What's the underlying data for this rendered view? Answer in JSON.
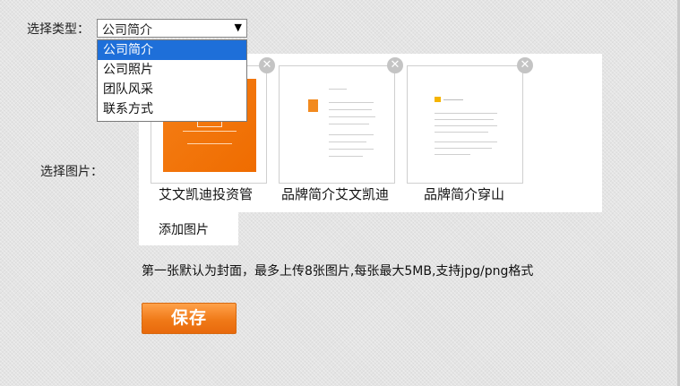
{
  "form": {
    "type_label": "选择类型：",
    "type_select": {
      "selected": "公司简介",
      "options": [
        "公司简介",
        "公司照片",
        "团队风采",
        "联系方式"
      ]
    },
    "image_label": "选择图片：",
    "images": [
      {
        "caption": "艾文凯迪投资管"
      },
      {
        "caption": "品牌简介艾文凯迪"
      },
      {
        "caption": "品牌简介穿山"
      }
    ],
    "add_image_label": "添加图片",
    "hint": "第一张默认为封面，最多上传8张图片,每张最大5MB,支持jpg/png格式",
    "save_label": "保存"
  },
  "icons": {
    "close": "close-icon",
    "dropdown_arrow": "dropdown-arrow-icon"
  },
  "colors": {
    "accent": "#f07a18",
    "select_highlight": "#1e6fd9"
  }
}
